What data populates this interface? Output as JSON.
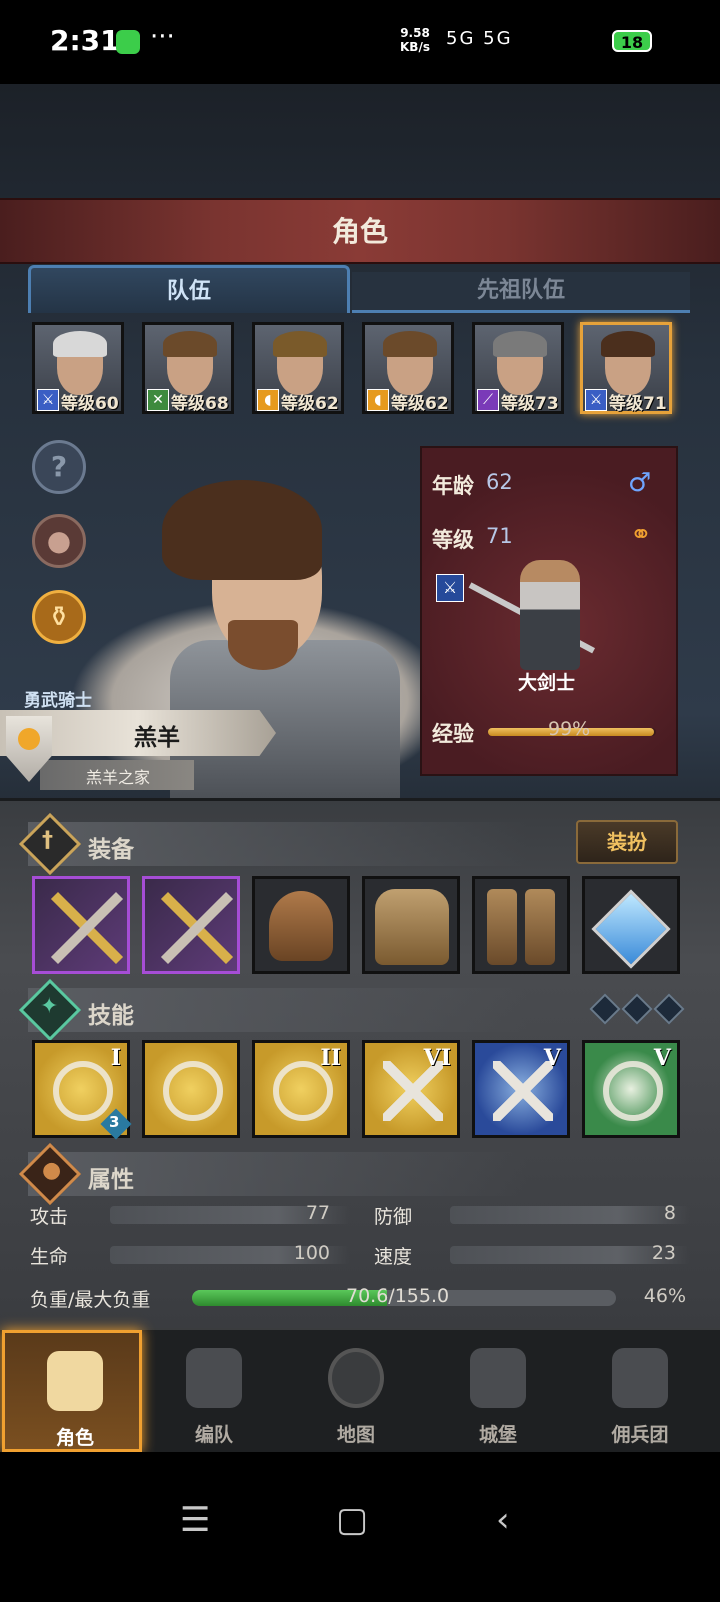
{
  "status_bar": {
    "time": "2:31",
    "more": "···",
    "net_speed_value": "9.58",
    "net_speed_unit": "KB/s",
    "signal": "5G 5G",
    "battery": "18"
  },
  "header": {
    "title": "角色"
  },
  "tabs": [
    {
      "label": "队伍",
      "active": true
    },
    {
      "label": "先祖队伍",
      "active": false
    }
  ],
  "roster": [
    {
      "level_text": "等级60",
      "class_icon": "sword-icon",
      "class_color": "#3a5ec4",
      "hair": "#d8d8d8"
    },
    {
      "level_text": "等级68",
      "class_icon": "crossed-arrows-icon",
      "class_color": "#3e8a3e",
      "hair": "#6b4a2a"
    },
    {
      "level_text": "等级62",
      "class_icon": "shield-icon",
      "class_color": "#e69a1e",
      "hair": "#7a5a2a"
    },
    {
      "level_text": "等级62",
      "class_icon": "shield-icon",
      "class_color": "#e69a1e",
      "hair": "#6b4a2a"
    },
    {
      "level_text": "等级73",
      "class_icon": "staff-icon",
      "class_color": "#7a3ab8",
      "hair": "#7a7a7a"
    },
    {
      "level_text": "等级71",
      "class_icon": "sword-icon",
      "class_color": "#3a5ec4",
      "hair": "#4b2f1d"
    }
  ],
  "character": {
    "age_label": "年龄",
    "age": "62",
    "level_label": "等级",
    "level": "71",
    "class_name": "大剑士",
    "exp_label": "经验",
    "exp_percent": "99%",
    "exp_fraction": 0.99,
    "title": "勇武骑士",
    "name": "羔羊",
    "house": "羔羊之家"
  },
  "equipment": {
    "section_title": "装备",
    "dress_up_label": "装扮",
    "slots": [
      "greatsword",
      "greatsword",
      "helmet",
      "armor",
      "boots",
      "amulet"
    ]
  },
  "skills": {
    "section_title": "技能",
    "items": [
      {
        "name": "whirlwind",
        "rank": "I",
        "badge": "3",
        "bg": "#c79a2a"
      },
      {
        "name": "sword-aura",
        "rank": "",
        "badge": "",
        "bg": "#c79a2a"
      },
      {
        "name": "sword-aura-2",
        "rank": "II",
        "badge": "",
        "bg": "#c79a2a"
      },
      {
        "name": "cross-slash",
        "rank": "VI",
        "badge": "",
        "bg": "#c79a2a"
      },
      {
        "name": "cross-slash-blue",
        "rank": "V",
        "badge": "",
        "bg": "#2a4a9a"
      },
      {
        "name": "burst",
        "rank": "V",
        "badge": "",
        "bg": "#3a8a4a"
      }
    ]
  },
  "attributes": {
    "section_title": "属性",
    "attack_label": "攻击",
    "attack": "77",
    "defense_label": "防御",
    "defense": "8",
    "hp_label": "生命",
    "hp": "100",
    "speed_label": "速度",
    "speed": "23",
    "load_label": "负重/最大负重",
    "load": "70.6/155.0",
    "load_percent": "46%",
    "load_fraction": 0.46
  },
  "bottom_nav": [
    {
      "label": "角色",
      "active": true
    },
    {
      "label": "编队",
      "active": false
    },
    {
      "label": "地图",
      "active": false
    },
    {
      "label": "城堡",
      "active": false
    },
    {
      "label": "佣兵团",
      "active": false
    }
  ],
  "colors": {
    "accent_gold": "#f0a030",
    "tab_blue": "#4d7fb2",
    "weapon_rarity": "#a64dd6"
  }
}
